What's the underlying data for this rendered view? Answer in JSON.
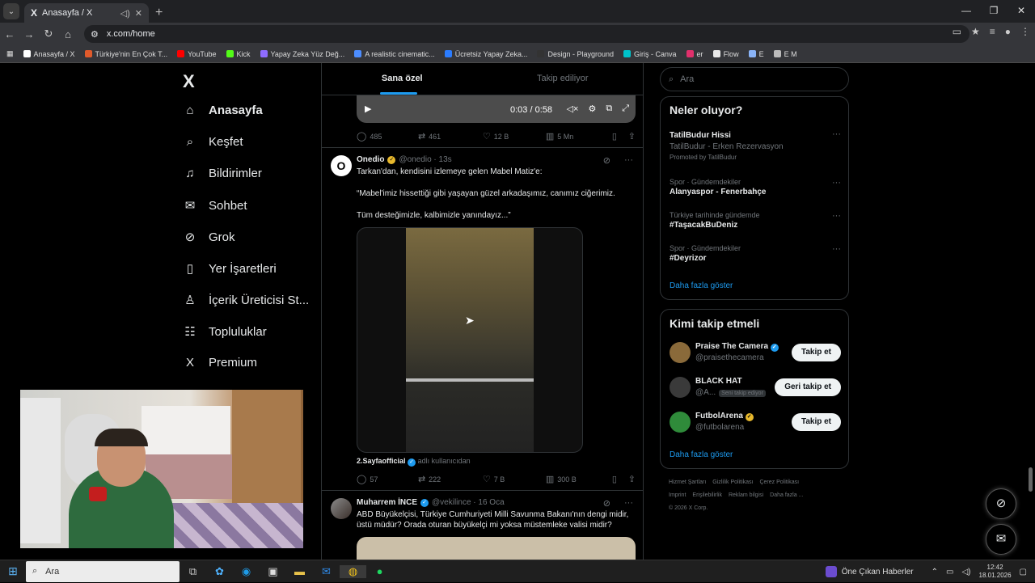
{
  "browser": {
    "tab_title": "Anasayfa / X",
    "url": "x.com/home",
    "bookmarks": [
      {
        "label": "Anasayfa / X",
        "color": "#ffffff"
      },
      {
        "label": "Türkiye'nin En Çok T...",
        "color": "#e05a2b"
      },
      {
        "label": "YouTube",
        "color": "#ff0000"
      },
      {
        "label": "Kick",
        "color": "#53fc18"
      },
      {
        "label": "Yapay Zeka Yüz Değ...",
        "color": "#8e6cff"
      },
      {
        "label": "A realistic cinematic...",
        "color": "#4c8dff"
      },
      {
        "label": "Ücretsiz Yapay Zeka...",
        "color": "#2b7cff"
      },
      {
        "label": "Design - Playground",
        "color": "#333333"
      },
      {
        "label": "Giriş - Canva",
        "color": "#00c4cc"
      },
      {
        "label": "er",
        "color": "#e1306c"
      },
      {
        "label": "Flow",
        "color": "#e8e8e8"
      },
      {
        "label": "E",
        "color": "#8ab4f8"
      },
      {
        "label": "E M",
        "color": "#bbbbbb"
      }
    ]
  },
  "nav": {
    "logo": "X",
    "items": [
      {
        "label": "Anasayfa",
        "icon": "home-icon",
        "glyph": "⌂"
      },
      {
        "label": "Keşfet",
        "icon": "search-icon",
        "glyph": "⌕"
      },
      {
        "label": "Bildirimler",
        "icon": "bell-icon",
        "glyph": "♫"
      },
      {
        "label": "Sohbet",
        "icon": "mail-icon",
        "glyph": "✉"
      },
      {
        "label": "Grok",
        "icon": "grok-icon",
        "glyph": "⊘"
      },
      {
        "label": "Yer İşaretleri",
        "icon": "bookmark-icon",
        "glyph": "▯"
      },
      {
        "label": "İçerik Üreticisi St...",
        "icon": "creator-icon",
        "glyph": "♙"
      },
      {
        "label": "Topluluklar",
        "icon": "communities-icon",
        "glyph": "☷"
      },
      {
        "label": "Premium",
        "icon": "x-premium-icon",
        "glyph": "X"
      }
    ]
  },
  "feed": {
    "tabs": [
      "Sana özel",
      "Takip ediliyor"
    ],
    "video_time": "0:03 / 0:58",
    "post1_stats": {
      "replies": "485",
      "reposts": "461",
      "likes": "12 B",
      "views": "5 Mn"
    },
    "post2": {
      "name": "Onedio",
      "handle": "@onedio · 13s",
      "lines": [
        "Tarkan'dan, kendisini izlemeye gelen Mabel Matiz'e:",
        "“Mabel'imiz hissettiği gibi yaşayan güzel arkadaşımız, canımız ciğerimiz.",
        "Tüm desteğimizle, kalbimizle yanındayız...”"
      ],
      "via_name": "2.Sayfaofficial",
      "via_text": "adlı kullanıcıdan",
      "stats": {
        "replies": "57",
        "reposts": "222",
        "likes": "7 B",
        "views": "300 B"
      }
    },
    "post3": {
      "name": "Muharrem İNCE",
      "handle": "@vekilince · 16 Oca",
      "lines": [
        "ABD Büyükelçisi, Türkiye Cumhuriyeti Milli Savunma Bakanı'nın dengi midir,",
        "üstü müdür? Orada oturan büyükelçi mi yoksa müstemleke valisi midir?"
      ]
    }
  },
  "right": {
    "search_placeholder": "Ara",
    "trends_title": "Neler oluyor?",
    "trends": [
      {
        "meta": "",
        "title": "TatilBudur Hissi",
        "sub": "TatilBudur - Erken Rezervasyon",
        "promo": "Promoted by TatilBudur"
      },
      {
        "meta": "Spor · Gündemdekiler",
        "title": "Alanyaspor - Fenerbahçe"
      },
      {
        "meta": "Türkiye tarihinde gündemde",
        "title": "#TaşacakBuDeniz"
      },
      {
        "meta": "Spor · Gündemdekiler",
        "title": "#Deyrizor"
      }
    ],
    "show_more": "Daha fazla göster",
    "who_title": "Kimi takip etmeli",
    "who": [
      {
        "name": "Praise The Camera",
        "handle": "@praisethecamera",
        "button": "Takip et",
        "badge": ""
      },
      {
        "name": "BLACK HAT",
        "handle": "@A...",
        "button": "Geri takip et",
        "badge": "Seni takip ediyor"
      },
      {
        "name": "FutbolArena",
        "handle": "@futbolarena",
        "button": "Takip et",
        "badge": ""
      }
    ],
    "footer_links": [
      "Hizmet Şartları",
      "Gizlilik Politikası",
      "Çerez Politikası",
      "Imprint",
      "Erişilebilirlik",
      "Reklam bilgisi",
      "Daha fazla ...",
      "© 2026 X Corp."
    ]
  },
  "taskbar": {
    "search": "Ara",
    "news": "Öne Çıkan Haberler",
    "time": "12:42",
    "date": "18.01.2026"
  }
}
